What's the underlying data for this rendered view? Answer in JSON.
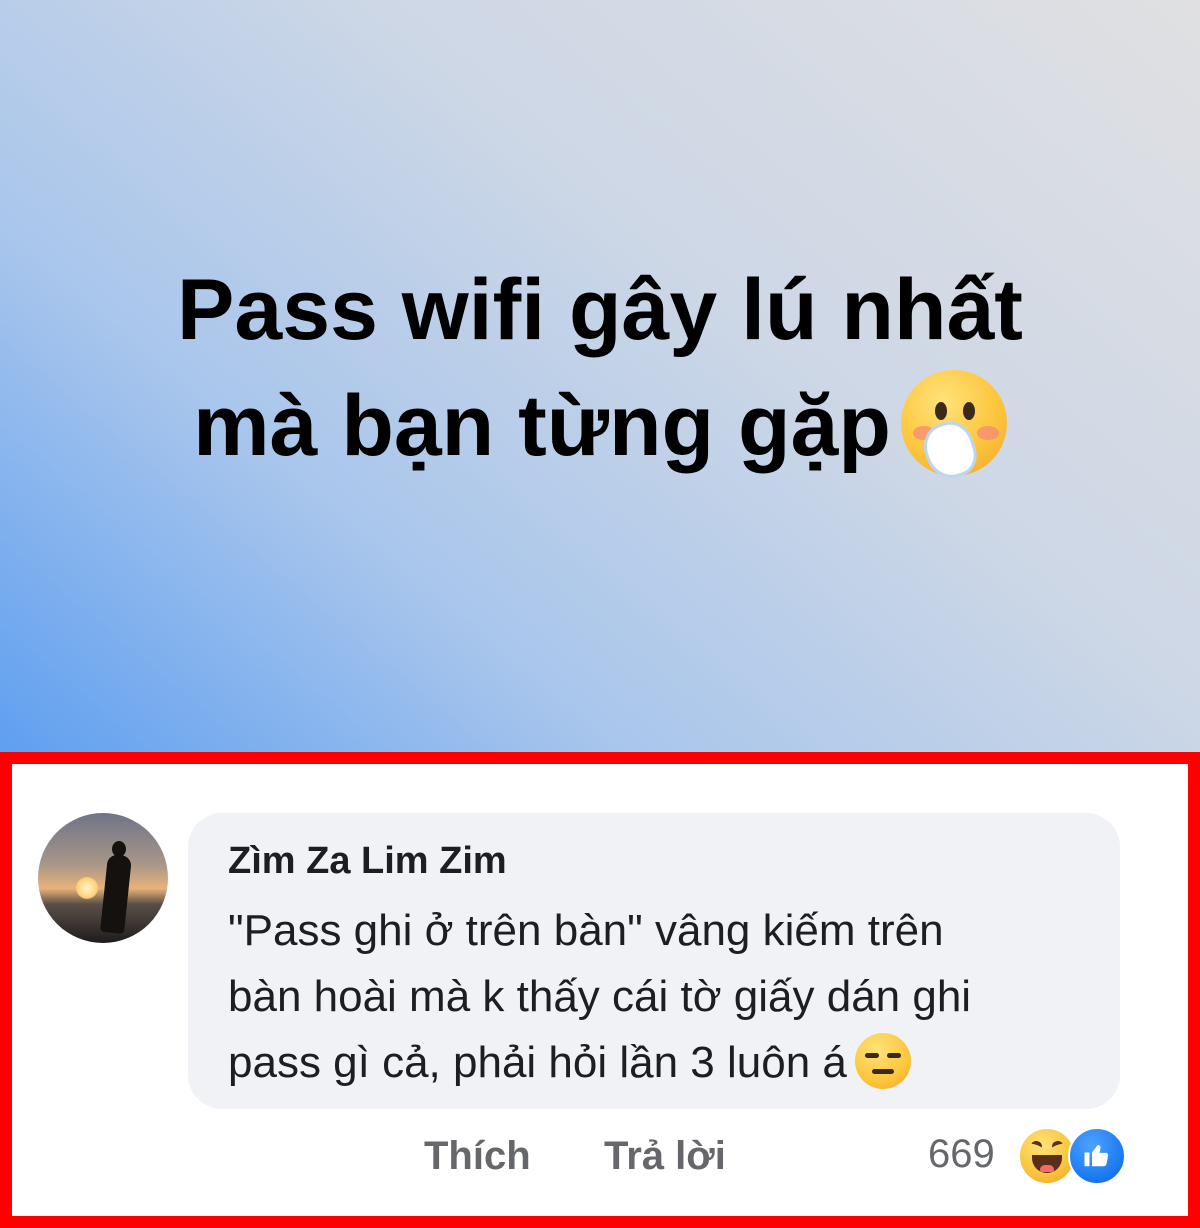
{
  "post": {
    "line1": "Pass wifi gây lú nhất",
    "line2": "mà bạn từng gặp",
    "emoji": "face-with-hand-over-mouth-icon",
    "background_colors": [
      "#5f9ff0",
      "#e0e0e2"
    ]
  },
  "comment": {
    "author": "Zìm Za Lim Zim",
    "lines": [
      "\"Pass ghi ở trên bàn\" vâng kiếm trên",
      "bàn hoài mà k thấy cái tờ giấy dán ghi",
      "pass gì cả, phải hỏi lần 3 luôn á"
    ],
    "trailing_emoji": "expressionless-face-icon",
    "bubble_color": "#f0f2f5"
  },
  "actions": {
    "like_label": "Thích",
    "reply_label": "Trả lời"
  },
  "reactions": {
    "count": "669",
    "icons": [
      "haha-icon",
      "like-icon"
    ]
  },
  "highlight": {
    "border_color": "#ff0000"
  }
}
